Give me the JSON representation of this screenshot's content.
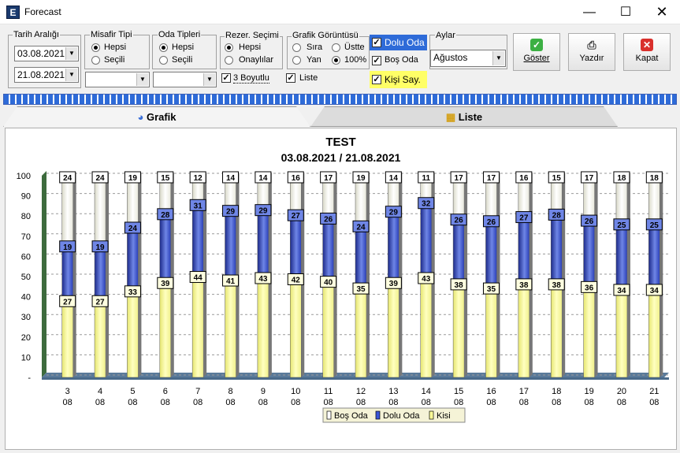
{
  "window": {
    "title": "Forecast",
    "app_icon_letter": "E"
  },
  "filters": {
    "date_range": {
      "caption": "Tarih Aralığı",
      "start": "03.08.2021",
      "end": "21.08.2021"
    },
    "guest_type": {
      "caption": "Misafir Tipi",
      "options": [
        "Hepsi",
        "Seçili"
      ],
      "selected": "Hepsi",
      "combo_value": ""
    },
    "room_types": {
      "caption": "Oda Tipleri",
      "options": [
        "Hepsi",
        "Seçili"
      ],
      "selected": "Hepsi",
      "combo_value": ""
    },
    "reservation": {
      "caption": "Rezer. Seçimi",
      "options": [
        "Hepsi",
        "Onaylılar"
      ],
      "selected": "Hepsi"
    },
    "three_d": {
      "label": "3 Boyutlu",
      "checked": true
    },
    "chart_view": {
      "caption": "Grafik Görüntüsü",
      "options": [
        "Sıra",
        "Üstte",
        "Yan",
        "100%"
      ],
      "selected": "100%"
    },
    "list": {
      "label": "Liste",
      "checked": true
    },
    "dolu_oda": {
      "label": "Dolu Oda",
      "checked": true,
      "color": "#2e6bd8"
    },
    "bos_oda": {
      "label": "Boş Oda",
      "checked": true
    },
    "kisi_say": {
      "label": "Kişi Say.",
      "checked": true,
      "color": "#ffff66"
    },
    "months": {
      "caption": "Aylar",
      "selected": "Ağustos"
    }
  },
  "buttons": {
    "show": {
      "label": "Göster",
      "icon": "check-icon",
      "color": "#3cb043"
    },
    "print": {
      "label": "Yazdır",
      "icon": "printer-icon"
    },
    "close": {
      "label": "Kapat",
      "icon": "close-icon",
      "color": "#d9302c"
    }
  },
  "tabs": {
    "chart": {
      "label": "Grafik",
      "icon": "pie-chart-icon",
      "active": true
    },
    "list": {
      "label": "Liste",
      "icon": "books-icon",
      "active": false
    }
  },
  "chart_data": {
    "type": "bar",
    "title": "TEST",
    "subtitle": "03.08.2021 / 21.08.2021",
    "categories": [
      "3 08",
      "4 08",
      "5 08",
      "6 08",
      "7 08",
      "8 08",
      "9 08",
      "10 08",
      "11 08",
      "12 08",
      "13 08",
      "14 08",
      "15 08",
      "16 08",
      "17 08",
      "18 08",
      "19 08",
      "20 08",
      "21 08"
    ],
    "series": [
      {
        "name": "Boş Oda",
        "values": [
          24,
          24,
          19,
          15,
          12,
          14,
          14,
          16,
          17,
          19,
          14,
          11,
          17,
          17,
          16,
          15,
          17,
          18,
          18
        ],
        "color": "#ffffff"
      },
      {
        "name": "Dolu Oda",
        "values": [
          19,
          19,
          24,
          28,
          31,
          29,
          29,
          27,
          26,
          24,
          29,
          32,
          26,
          26,
          27,
          28,
          26,
          25,
          25
        ],
        "color": "#3a55d8"
      },
      {
        "name": "Kisi",
        "values": [
          27,
          27,
          33,
          39,
          44,
          41,
          43,
          42,
          40,
          35,
          39,
          43,
          38,
          35,
          38,
          38,
          36,
          34,
          34
        ],
        "color": "#ffff99"
      }
    ],
    "ylim": [
      0,
      100
    ],
    "yticks": [
      "100",
      "90",
      "80",
      "70",
      "60",
      "50",
      "40",
      "30",
      "20",
      "10",
      "-"
    ],
    "stacking": "100%",
    "three_d": true,
    "grid": true,
    "legend": "bottom"
  }
}
